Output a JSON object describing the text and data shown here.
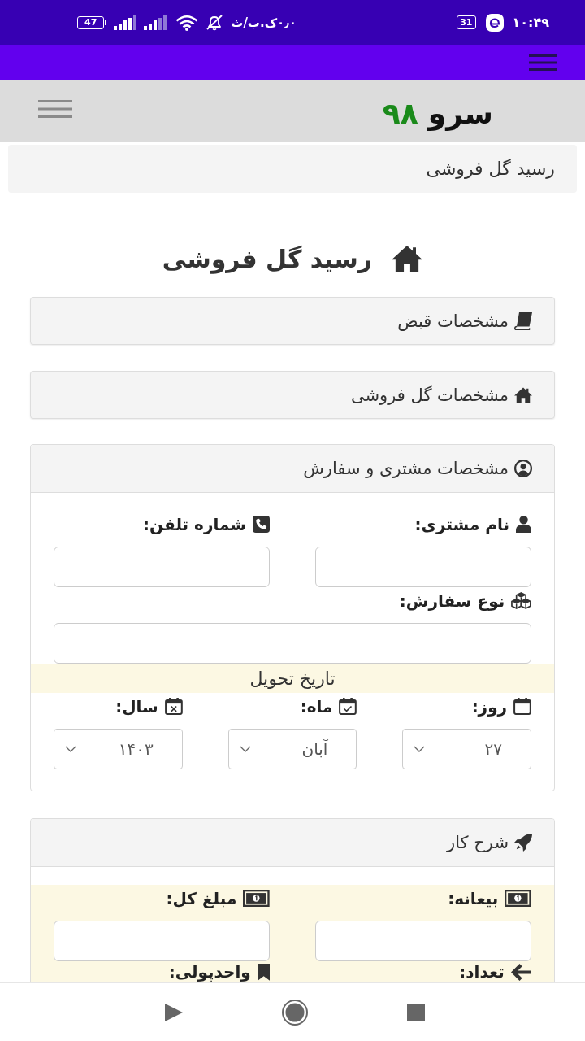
{
  "status_bar": {
    "battery": "47",
    "network_speed": "۰٫۰ک.ب/ث",
    "calendar_day": "31",
    "time": "۱۰:۴۹"
  },
  "header": {
    "logo_text": "سرو",
    "logo_number": "۹۸"
  },
  "breadcrumb": "رسید گل فروشی",
  "page_title": "رسید گل فروشی",
  "panels": [
    {
      "title": "مشخصات قبض",
      "expanded": false
    },
    {
      "title": "مشخصات گل فروشی",
      "expanded": false
    },
    {
      "title": "مشخصات مشتری و سفارش",
      "expanded": true,
      "body": [
        {
          "kind": "inputs",
          "highlighted": false,
          "fields": [
            {
              "label": "نام مشتری:"
            },
            {
              "label": "شماره تلفن:"
            }
          ]
        },
        {
          "kind": "inputs",
          "highlighted": false,
          "fields": [
            {
              "label": "نوع سفارش:"
            }
          ]
        },
        {
          "kind": "band",
          "highlighted": true,
          "text": "تاریخ تحویل"
        },
        {
          "kind": "selects",
          "highlighted": false,
          "fields": [
            {
              "label": "روز:",
              "value": "۲۷"
            },
            {
              "label": "ماه:",
              "value": "آبان"
            },
            {
              "label": "سال:",
              "value": "۱۴۰۳"
            }
          ]
        }
      ]
    },
    {
      "title": "شرح کار",
      "expanded": true,
      "body": [
        {
          "kind": "inputs",
          "highlighted": true,
          "fields": [
            {
              "label": "بیعانه:"
            },
            {
              "label": "مبلغ کل:"
            }
          ]
        },
        {
          "kind": "labels",
          "highlighted": true,
          "fields": [
            {
              "label": "تعداد:"
            },
            {
              "label": "واحدپولی:"
            }
          ]
        }
      ]
    }
  ]
}
